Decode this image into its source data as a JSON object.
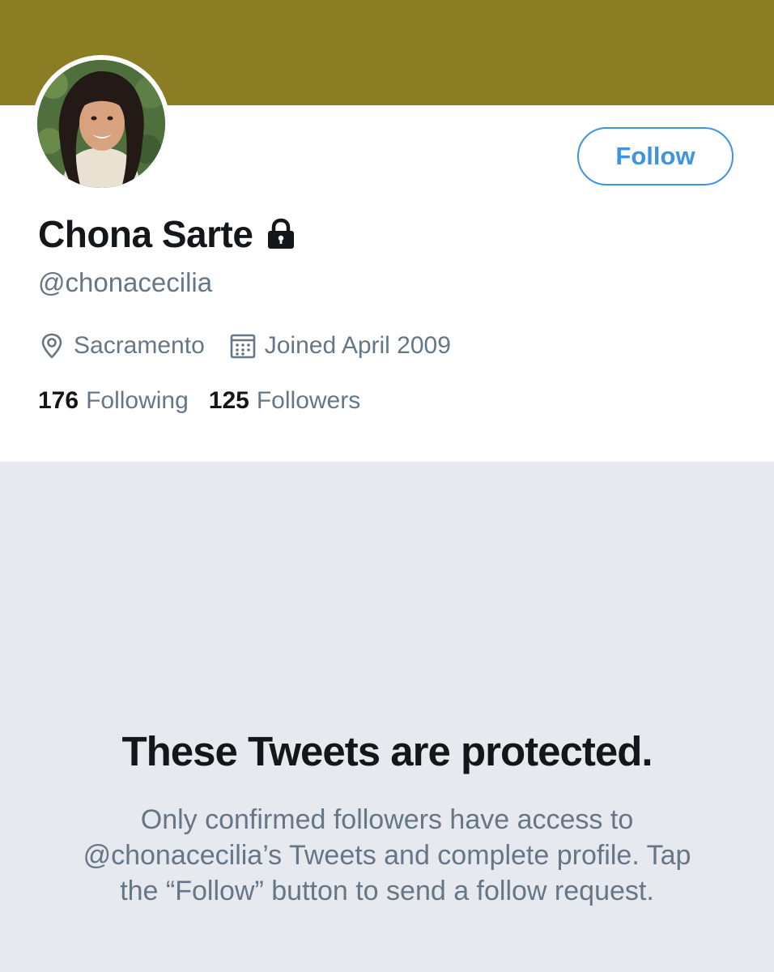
{
  "colors": {
    "banner": "#8a7d24",
    "accent": "#3d94e0",
    "text_primary": "#14171a",
    "text_secondary": "#657786",
    "protected_bg": "#e6e9ee"
  },
  "profile": {
    "display_name": "Chona Sarte",
    "protected_icon": "lock-icon",
    "handle": "@chonacecilia",
    "location": "Sacramento",
    "location_icon": "location-pin-icon",
    "joined": "Joined April 2009",
    "joined_icon": "calendar-icon",
    "follow_label": "Follow"
  },
  "stats": {
    "following_count": "176",
    "following_label": "Following",
    "followers_count": "125",
    "followers_label": "Followers"
  },
  "protected": {
    "title": "These Tweets are protected.",
    "description": "Only confirmed followers have access to @chonacecilia’s Tweets and complete profile. Tap the “Follow” button to send a follow request."
  }
}
